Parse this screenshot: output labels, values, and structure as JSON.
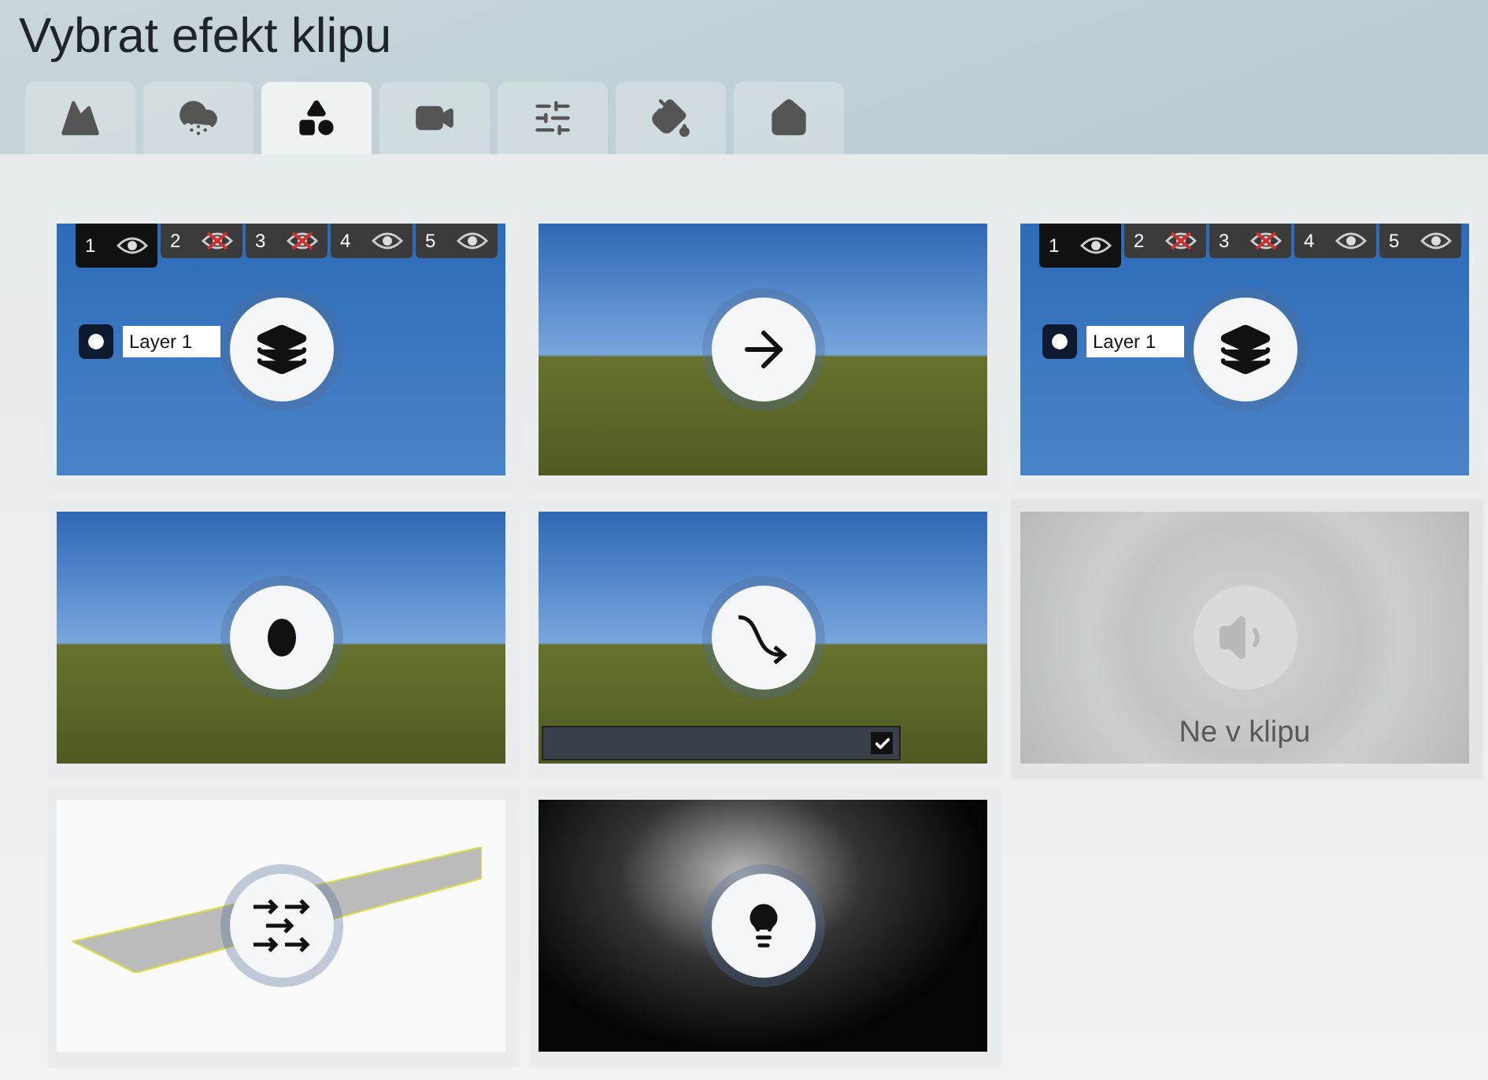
{
  "window": {
    "title": "Vybrat efekt klipu"
  },
  "tabs": [
    {
      "selected": false
    },
    {
      "selected": false
    },
    {
      "selected": true
    },
    {
      "selected": false
    },
    {
      "selected": false
    },
    {
      "selected": false
    },
    {
      "selected": false
    }
  ],
  "tiles": [
    {
      "kind": "layers",
      "disabled": false,
      "layer_tabs": [
        {
          "label": "1",
          "selected": true,
          "visible": true
        },
        {
          "label": "2",
          "selected": false,
          "visible": false
        },
        {
          "label": "3",
          "selected": false,
          "visible": false
        },
        {
          "label": "4",
          "selected": false,
          "visible": true
        },
        {
          "label": "5",
          "selected": false,
          "visible": true
        }
      ],
      "layer_name": "Layer 1"
    },
    {
      "kind": "motion",
      "disabled": false
    },
    {
      "kind": "layers",
      "disabled": false,
      "layer_tabs": [
        {
          "label": "1",
          "selected": true,
          "visible": true
        },
        {
          "label": "2",
          "selected": false,
          "visible": false
        },
        {
          "label": "3",
          "selected": false,
          "visible": false
        },
        {
          "label": "4",
          "selected": false,
          "visible": true
        },
        {
          "label": "5",
          "selected": false,
          "visible": true
        }
      ],
      "layer_name": "Layer 1"
    },
    {
      "kind": "stack",
      "disabled": false
    },
    {
      "kind": "path",
      "disabled": false
    },
    {
      "kind": "sound",
      "disabled": true,
      "caption": "Ne v klipu"
    },
    {
      "kind": "crowd",
      "disabled": false
    },
    {
      "kind": "light",
      "disabled": false
    }
  ]
}
